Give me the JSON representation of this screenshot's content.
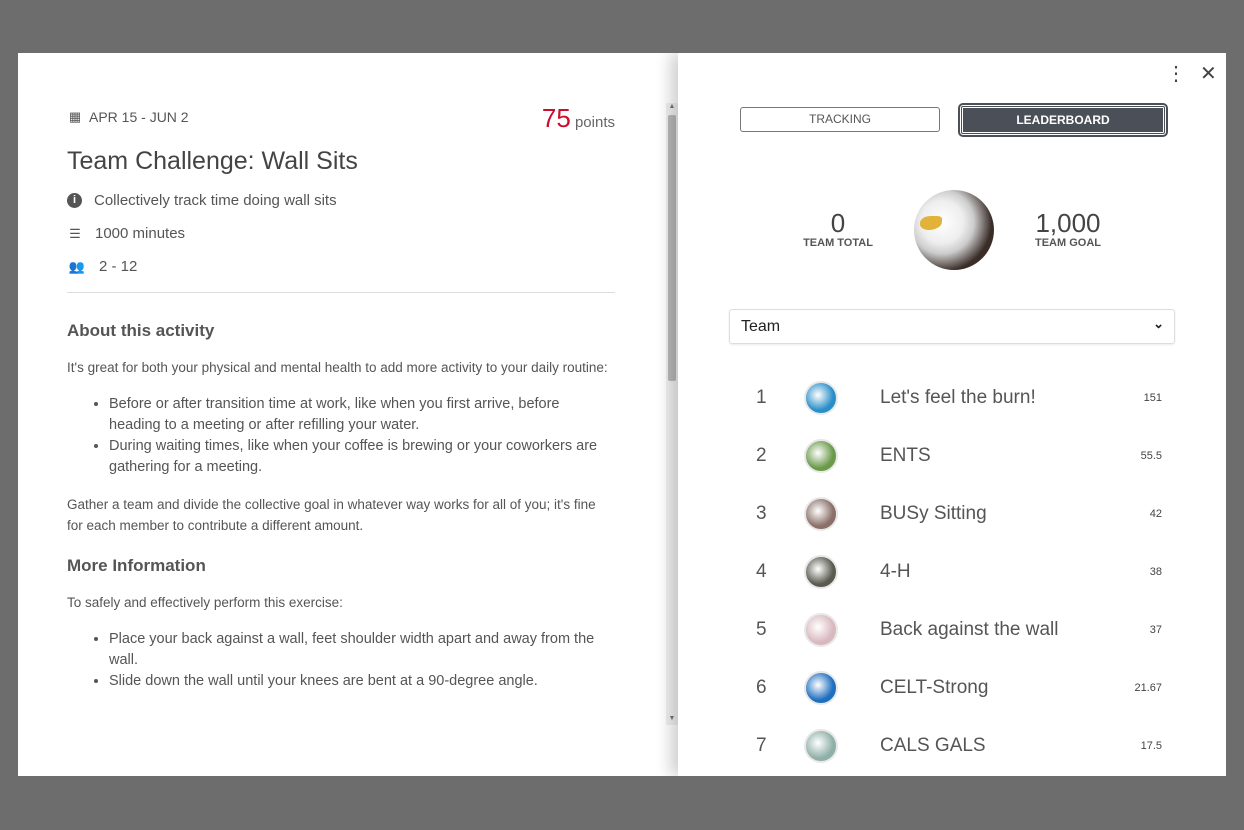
{
  "activity": {
    "date_range": "APR 15 - JUN 2",
    "points_value": "75",
    "points_label": "points",
    "title": "Team Challenge: Wall Sits",
    "description": "Collectively track time doing wall sits",
    "goal": "1000 minutes",
    "team_size": "2 - 12",
    "about_heading": "About this activity",
    "about_intro": "It's great for both your physical and mental health to add more activity to your daily routine:",
    "about_bullets": [
      "Before or after transition time at work, like when you first arrive, before heading to a meeting or after refilling your water.",
      "During waiting times, like when your coffee is brewing or your coworkers are gathering for a meeting."
    ],
    "about_outro": "Gather a team and divide the collective goal in whatever way works for all of you; it's fine for each member to contribute a different amount.",
    "more_heading": "More Information",
    "more_intro": "To safely and effectively perform this exercise:",
    "more_bullets": [
      "Place your back against a wall, feet shoulder width apart and away from the wall.",
      "Slide down the wall until your knees are bent at a 90-degree angle."
    ]
  },
  "tabs": {
    "tracking": "TRACKING",
    "leaderboard": "LEADERBOARD",
    "active": "leaderboard"
  },
  "stats": {
    "team_total": "0",
    "team_total_label": "TEAM TOTAL",
    "team_goal": "1,000",
    "team_goal_label": "TEAM GOAL"
  },
  "filter": {
    "selected": "Team"
  },
  "leaderboard": [
    {
      "rank": "1",
      "name": "Let's feel the burn!",
      "score": "151",
      "color": "#2a8fc9"
    },
    {
      "rank": "2",
      "name": "ENTS",
      "score": "55.5",
      "color": "#6a9a4a"
    },
    {
      "rank": "3",
      "name": "BUSy Sitting",
      "score": "42",
      "color": "#8a7068"
    },
    {
      "rank": "4",
      "name": "4-H",
      "score": "38",
      "color": "#5a5a50"
    },
    {
      "rank": "5",
      "name": "Back against the wall",
      "score": "37",
      "color": "#d9b9c0"
    },
    {
      "rank": "6",
      "name": "CELT-Strong",
      "score": "21.67",
      "color": "#1f6fc0"
    },
    {
      "rank": "7",
      "name": "CALS GALS",
      "score": "17.5",
      "color": "#8fb0a8"
    }
  ],
  "colors": {
    "accent": "#c8102e",
    "active_tab": "#4b4f57",
    "backdrop": "#6d6d6d"
  }
}
